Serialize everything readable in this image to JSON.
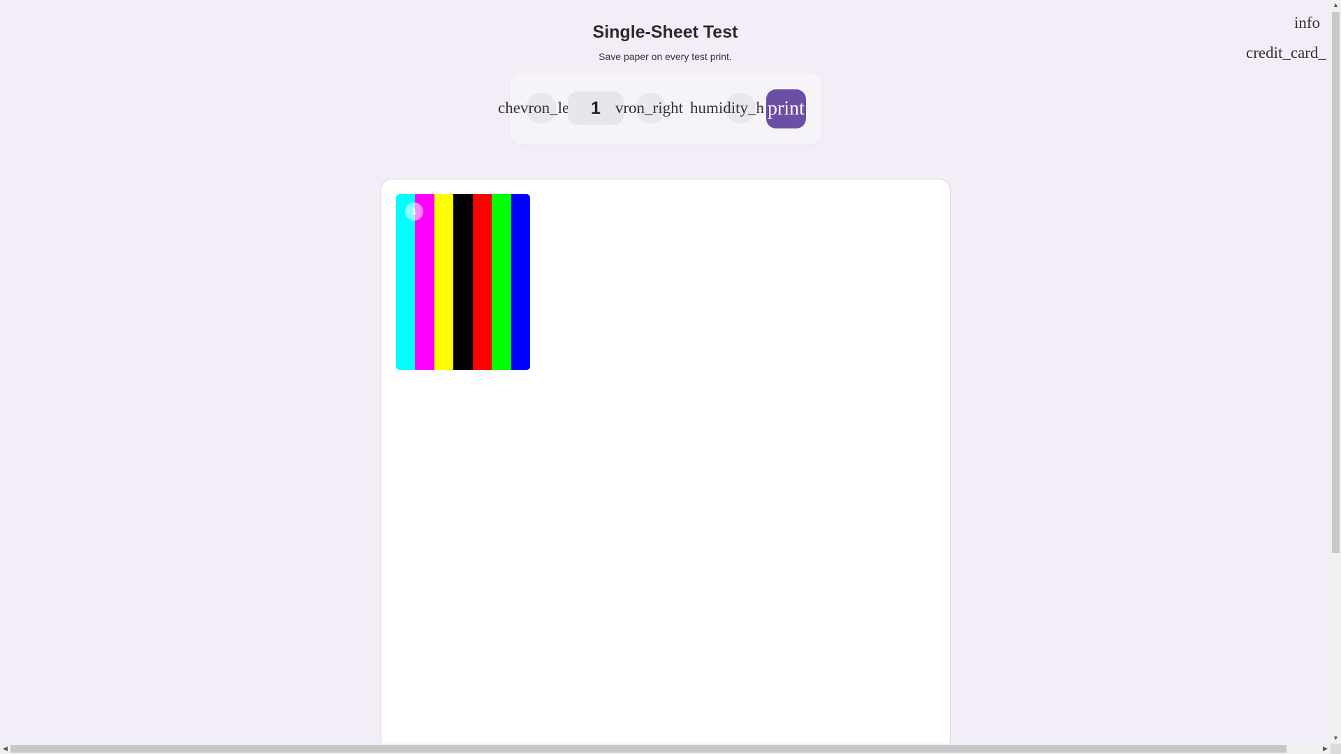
{
  "header": {
    "title": "Single-Sheet Test",
    "subtitle": "Save paper on every test print."
  },
  "top_icons": {
    "info": "info",
    "card": "credit_card_"
  },
  "controls": {
    "prev_icon": "chevron_left",
    "page_value": "1",
    "next_icon": "chevron_right",
    "humidity_icon": "humidity_high",
    "print_label": "print",
    "accent": "#6a4fa5"
  },
  "sheet": {
    "badge": "1",
    "bar_colors": [
      "#00ffff",
      "#ff00ff",
      "#ffff00",
      "#000000",
      "#ff0000",
      "#00ff00",
      "#0000ff"
    ]
  }
}
